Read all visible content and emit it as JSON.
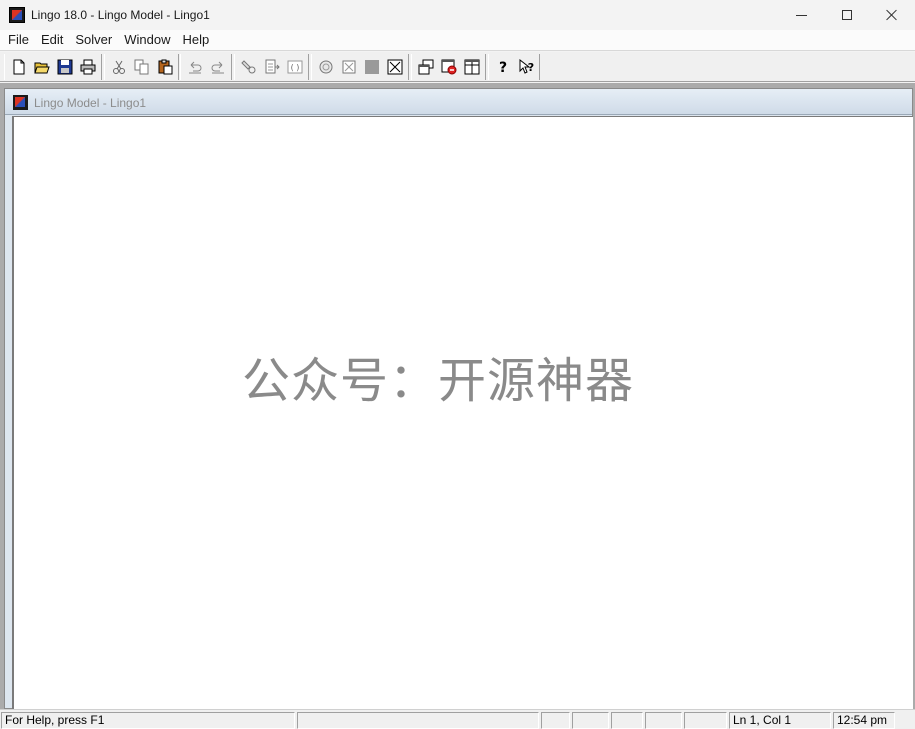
{
  "window": {
    "title": "Lingo 18.0 - Lingo Model - Lingo1",
    "icon": "lingo-app-icon"
  },
  "menu": [
    {
      "label": "File"
    },
    {
      "label": "Edit"
    },
    {
      "label": "Solver"
    },
    {
      "label": "Window"
    },
    {
      "label": "Help"
    }
  ],
  "toolbar": {
    "groups": [
      [
        "new-icon",
        "open-icon",
        "save-icon",
        "print-icon"
      ],
      [
        "cut-icon",
        "copy-icon",
        "paste-icon"
      ],
      [
        "undo-icon",
        "redo-icon"
      ],
      [
        "find-icon",
        "goto-line-icon",
        "match-parenthesis-icon"
      ],
      [
        "solve-icon",
        "close-solution-icon",
        "send-to-back-icon",
        "close-all-icon"
      ],
      [
        "tile-icon",
        "options-icon",
        "grid-icon"
      ],
      [
        "help-icon",
        "context-help-icon"
      ]
    ]
  },
  "child_window": {
    "title": "Lingo Model - Lingo1"
  },
  "editor": {
    "watermark": "公众号：开源神器"
  },
  "statusbar": {
    "help_text": "For Help, press F1",
    "position": "Ln 1, Col 1",
    "time": "12:54 pm"
  }
}
